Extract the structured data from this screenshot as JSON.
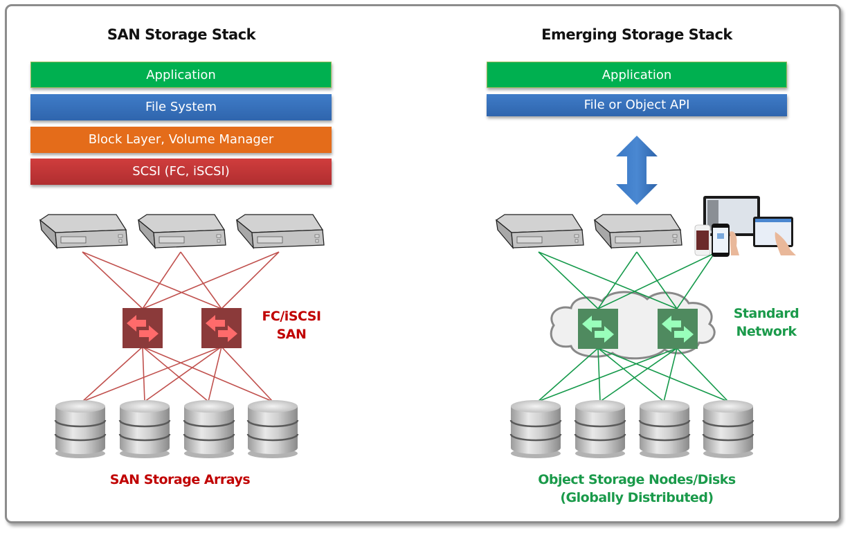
{
  "colors": {
    "application": "#00b050",
    "file_system": "#3a74be",
    "block_layer": "#e46c1a",
    "scsi": "#c8363a",
    "san_accent": "#c00000",
    "san_lines": "#c0504d",
    "san_switch": "#8b3a3a",
    "san_switch_arrows": "#ff6b6b",
    "net_accent": "#1a9a4a",
    "net_lines": "#14994a",
    "net_switch": "#4f8a5f",
    "net_switch_arrows": "#99ffbb"
  },
  "left": {
    "title": "SAN Storage Stack",
    "layers": [
      {
        "label": "Application"
      },
      {
        "label": "File System"
      },
      {
        "label": "Block Layer, Volume Manager"
      },
      {
        "label": "SCSI (FC, iSCSI)"
      }
    ],
    "network_label_line1": "FC/iSCSI",
    "network_label_line2": "SAN",
    "storage_label": "SAN Storage Arrays",
    "server_count": 3,
    "switch_count": 2,
    "disk_count": 4
  },
  "right": {
    "title": "Emerging Storage Stack",
    "layers": [
      {
        "label": "Application"
      },
      {
        "label": "File or Object API"
      }
    ],
    "network_label_line1": "Standard",
    "network_label_line2": "Network",
    "storage_label_line1": "Object Storage Nodes/Disks",
    "storage_label_line2": "(Globally Distributed)",
    "server_count": 2,
    "switch_count": 2,
    "disk_count": 4,
    "devices_icon": "mobile-devices-icon",
    "arrow_icon": "bidirectional-arrow-icon"
  }
}
